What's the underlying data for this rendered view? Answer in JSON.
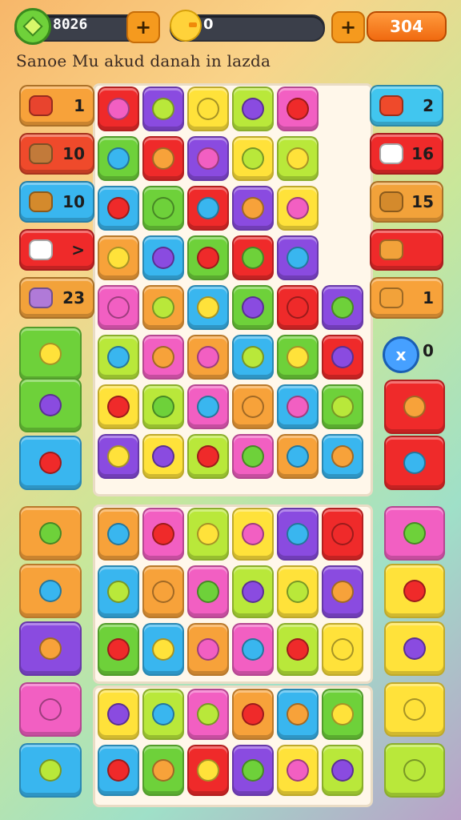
{
  "hud": {
    "coins": "8026",
    "plus_label": "+",
    "chick_value": "0",
    "score": "304"
  },
  "subtitle": "Sanoe Mu akud danah in lazda",
  "side_left": [
    {
      "label": "1",
      "color": "#f7a23a",
      "icon": "cake-icon",
      "icolor": "#e8442e"
    },
    {
      "label": "10",
      "color": "#ef4a2b",
      "icon": "bread-icon",
      "icolor": "#c27a3a"
    },
    {
      "label": "10",
      "color": "#39b6ef",
      "icon": "cookie-icon",
      "icolor": "#d48a2c"
    },
    {
      "label": ">",
      "color": "#ef2a2a",
      "icon": "cat-icon",
      "icolor": "#ffffff"
    },
    {
      "label": "23",
      "color": "#f2a23a",
      "icon": "cup-icon",
      "icolor": "#b07ad8"
    }
  ],
  "side_right": [
    {
      "label": "2",
      "color": "#41c6ef",
      "icon": "mail-icon",
      "icolor": "#ef4a2b"
    },
    {
      "label": "16",
      "color": "#ef2a2a",
      "icon": "flower-icon",
      "icolor": "#ffffff"
    },
    {
      "label": "15",
      "color": "#f2a23a",
      "icon": "drum-icon",
      "icolor": "#d48a2c"
    },
    {
      "label": "",
      "color": "#ef2a2a",
      "icon": "coin-icon",
      "icolor": "#f2a23a"
    },
    {
      "label": "1",
      "color": "#f7a23a",
      "icon": "fruit-icon",
      "icolor": "#f2a23a"
    }
  ],
  "round_button": {
    "icon": "x",
    "value": "0"
  },
  "colors": {
    "green": "#6ed13a",
    "red": "#ef2a2a",
    "orange": "#f7a23a",
    "yellow": "#ffe23a",
    "pink": "#f25fc2",
    "purple": "#8a4be0",
    "blue": "#39b6ef",
    "lime": "#b9e83a"
  }
}
